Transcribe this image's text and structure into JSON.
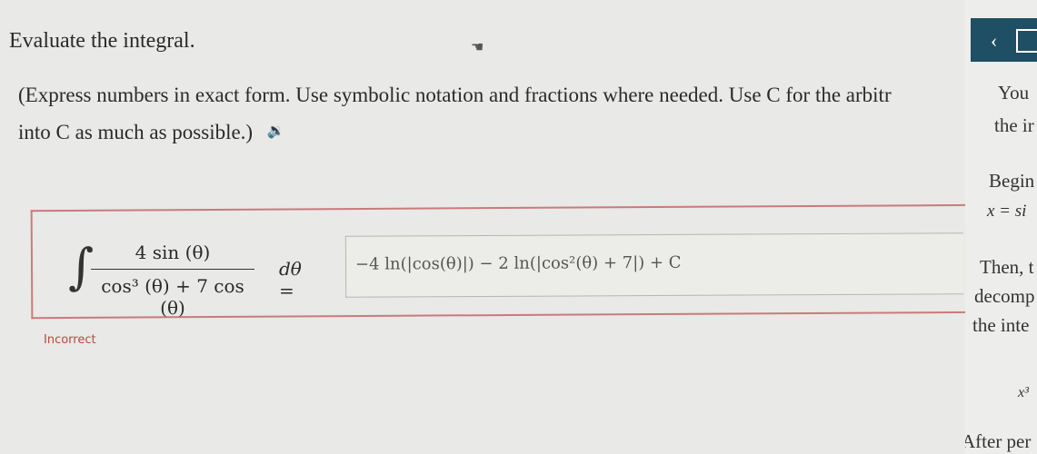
{
  "question": {
    "title": "Evaluate the integral.",
    "instructions_line1": "(Express numbers in exact form. Use symbolic notation and fractions where needed. Use C for the arbitr",
    "instructions_line2": "into C as much as possible.)",
    "integrand_numerator": "4 sin (θ)",
    "integrand_denominator": "cos³ (θ) + 7 cos (θ)",
    "differential": "dθ =",
    "answer_value": "−4 ln(|cos(θ)|) − 2 ln(|cos²(θ) + 7|) + C",
    "status": "Incorrect"
  },
  "side_panel": {
    "lines": [
      "You",
      "the ir",
      "Begin",
      "x = si",
      "Then, t",
      "decomp",
      "the inte",
      "x³",
      "After per"
    ]
  },
  "colors": {
    "status": "#b24c3b",
    "box_border": "#c97b7b",
    "side_bar": "#1f4f64"
  }
}
